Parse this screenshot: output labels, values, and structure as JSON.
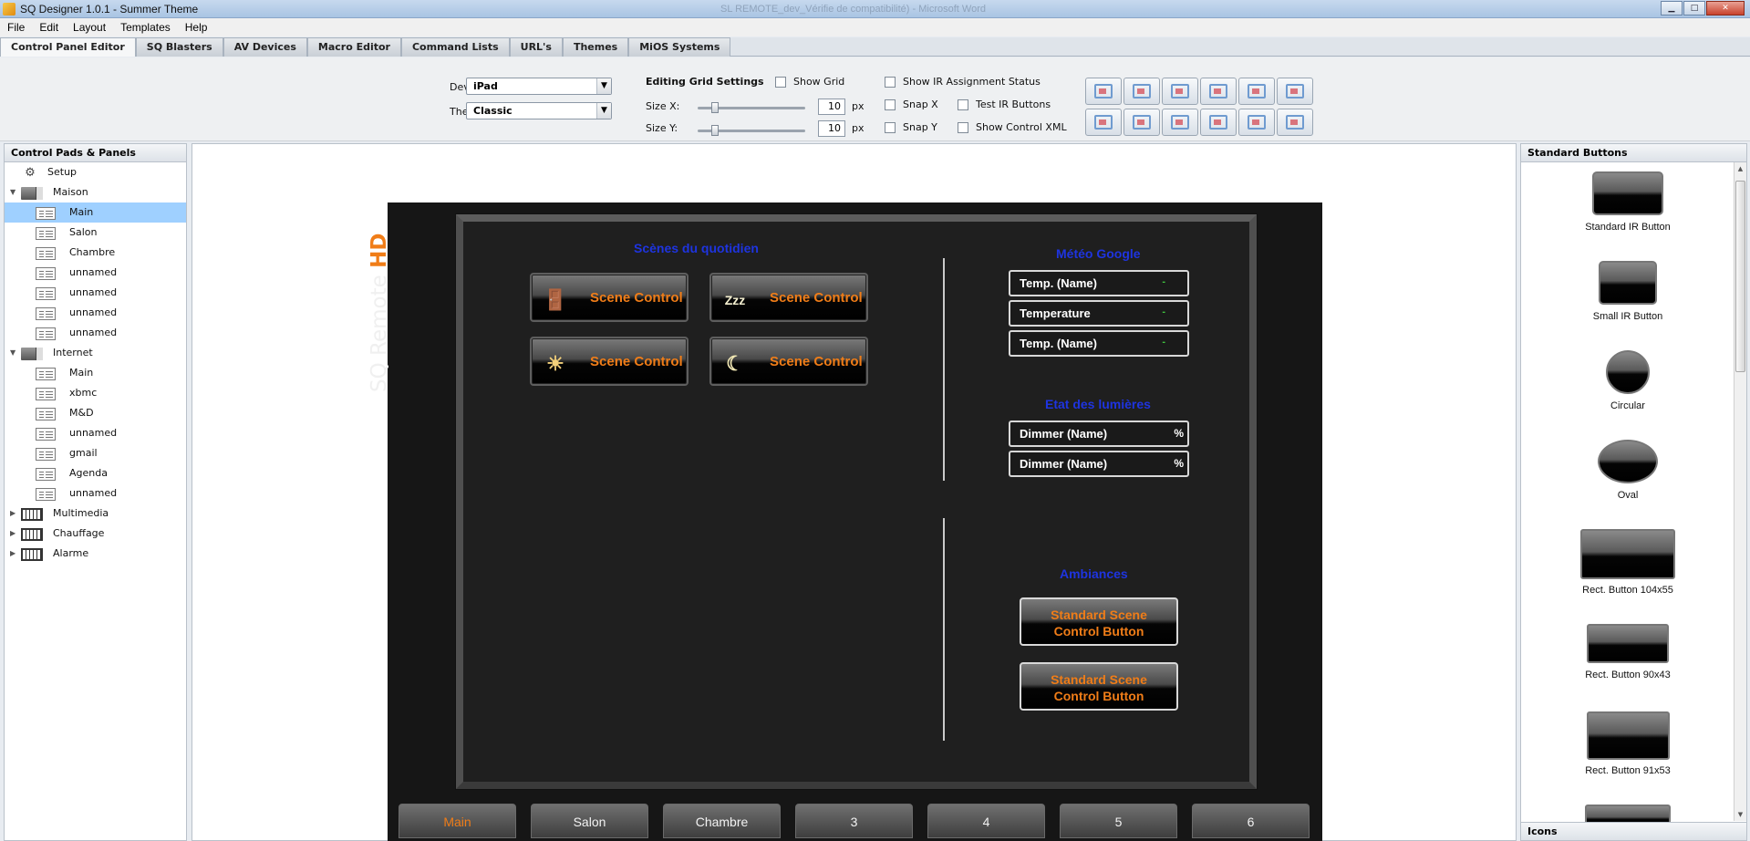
{
  "window": {
    "title": "SQ Designer 1.0.1 - Summer Theme",
    "faded_title": "SL REMOTE_dev_Vérifie de compatibilité) - Microsoft Word"
  },
  "menu": [
    "File",
    "Edit",
    "Layout",
    "Templates",
    "Help"
  ],
  "tabs": [
    "Control Panel Editor",
    "SQ Blasters",
    "AV Devices",
    "Macro Editor",
    "Command Lists",
    "URL's",
    "Themes",
    "MiOS Systems"
  ],
  "toolbar": {
    "device_label": "Device:",
    "device_value": "iPad",
    "theme_label": "Theme:",
    "theme_value": "Classic",
    "grid_title": "Editing Grid Settings",
    "show_grid": "Show Grid",
    "size_x_label": "Size X:",
    "size_x_value": "10",
    "size_y_label": "Size Y:",
    "size_y_value": "10",
    "unit": "px",
    "show_ir": "Show IR Assignment Status",
    "snap_x": "Snap X",
    "snap_y": "Snap Y",
    "test_ir": "Test IR Buttons",
    "show_xml": "Show Control XML"
  },
  "left_panel": {
    "header": "Control Pads & Panels",
    "items": [
      {
        "label": "Setup"
      },
      {
        "label": "Maison"
      },
      {
        "label": "Main"
      },
      {
        "label": "Salon"
      },
      {
        "label": "Chambre"
      },
      {
        "label": "unnamed"
      },
      {
        "label": "unnamed"
      },
      {
        "label": "unnamed"
      },
      {
        "label": "unnamed"
      },
      {
        "label": "Internet"
      },
      {
        "label": "Main"
      },
      {
        "label": "xbmc"
      },
      {
        "label": "M&D"
      },
      {
        "label": "unnamed"
      },
      {
        "label": "gmail"
      },
      {
        "label": "Agenda"
      },
      {
        "label": "unnamed"
      },
      {
        "label": "Multimedia"
      },
      {
        "label": "Chauffage"
      },
      {
        "label": "Alarme"
      }
    ]
  },
  "canvas": {
    "brand": "SQ Remote",
    "brand_hd": "HD",
    "scenes_title": "Scènes du quotidien",
    "scene_label": "Scene Control",
    "meteo_title": "Météo Google",
    "meteo_items": [
      {
        "name": "Temp. (Name)",
        "value": "-"
      },
      {
        "name": "Temperature",
        "value": "-"
      },
      {
        "name": "Temp. (Name)",
        "value": "-"
      }
    ],
    "lights_title": "Etat des lumières",
    "lights_items": [
      {
        "name": "Dimmer (Name)",
        "value": "%"
      },
      {
        "name": "Dimmer (Name)",
        "value": "%"
      }
    ],
    "ambiances_title": "Ambiances",
    "ambiance_line1": "Standard Scene",
    "ambiance_line2": "Control Button",
    "bottom_tabs": [
      "Main",
      "Salon",
      "Chambre",
      "3",
      "4",
      "5",
      "6"
    ]
  },
  "right_panel": {
    "header": "Standard Buttons",
    "items": [
      "Standard IR Button",
      "Small IR Button",
      "Circular",
      "Oval",
      "Rect. Button 104x55",
      "Rect. Button 90x43",
      "Rect. Button 91x53"
    ],
    "footer": "Icons"
  },
  "colors": {
    "accent": "#f07d18",
    "section_title": "#1e34e0",
    "selection": "#9fd0ff"
  }
}
